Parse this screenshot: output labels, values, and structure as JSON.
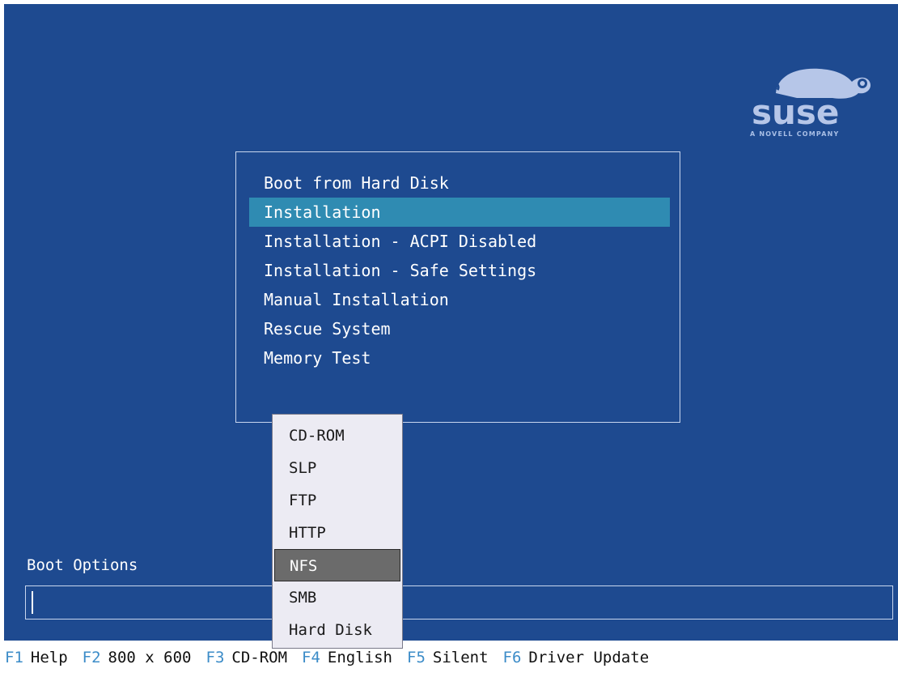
{
  "logo": {
    "wordmark": "suse",
    "tagline": "A NOVELL COMPANY",
    "icon": "chameleon-logo-icon"
  },
  "boot_menu": {
    "items": [
      {
        "label": "Boot from Hard Disk",
        "selected": false
      },
      {
        "label": "Installation",
        "selected": true
      },
      {
        "label": "Installation - ACPI Disabled",
        "selected": false
      },
      {
        "label": "Installation - Safe Settings",
        "selected": false
      },
      {
        "label": "Manual Installation",
        "selected": false
      },
      {
        "label": "Rescue System",
        "selected": false
      },
      {
        "label": "Memory Test",
        "selected": false
      }
    ]
  },
  "boot_options": {
    "label": "Boot Options",
    "value": ""
  },
  "source_popup": {
    "items": [
      {
        "label": "CD-ROM",
        "selected": false
      },
      {
        "label": "SLP",
        "selected": false
      },
      {
        "label": "FTP",
        "selected": false
      },
      {
        "label": "HTTP",
        "selected": false
      },
      {
        "label": "NFS",
        "selected": true
      },
      {
        "label": "SMB",
        "selected": false
      },
      {
        "label": "Hard Disk",
        "selected": false
      }
    ]
  },
  "fkeys": [
    {
      "key": "F1",
      "label": "Help"
    },
    {
      "key": "F2",
      "label": "800 x 600"
    },
    {
      "key": "F3",
      "label": "CD-ROM"
    },
    {
      "key": "F4",
      "label": "English"
    },
    {
      "key": "F5",
      "label": "Silent"
    },
    {
      "key": "F6",
      "label": "Driver Update"
    }
  ],
  "colors": {
    "background": "#1e4a90",
    "highlight": "#2f8bb2",
    "fkey_accent": "#3c8cc8",
    "popup_bg": "#ecebf3",
    "popup_selected": "#6b6b6b"
  }
}
